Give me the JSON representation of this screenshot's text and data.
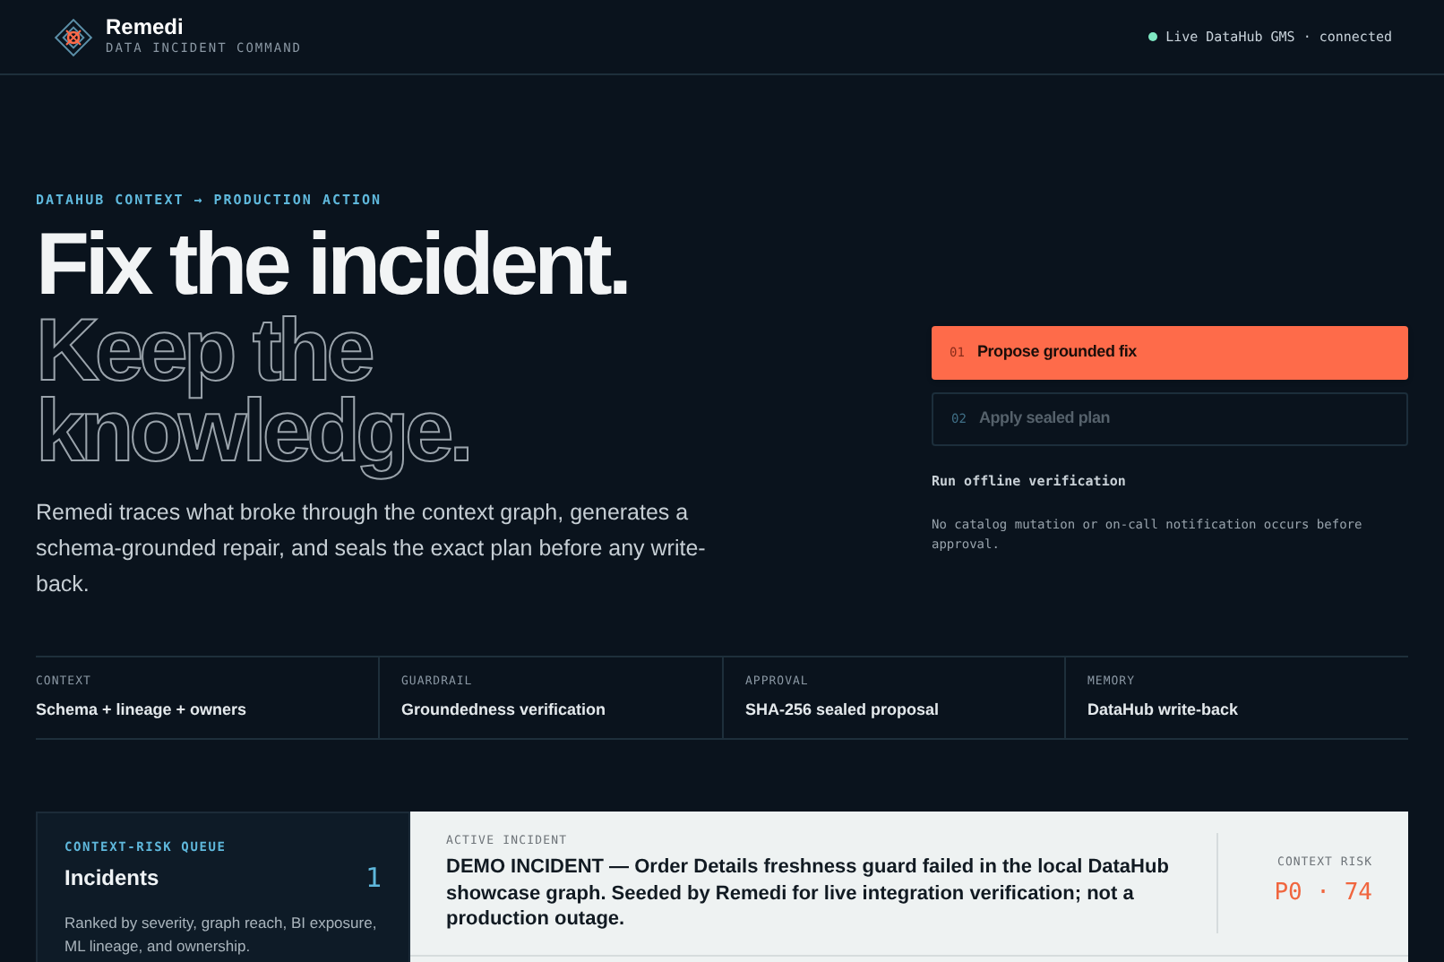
{
  "header": {
    "brand": "Remedi",
    "tagline": "DATA INCIDENT COMMAND",
    "status": {
      "label": "Live DataHub GMS · connected",
      "on": true
    }
  },
  "hero": {
    "eyebrow": "DATAHUB CONTEXT → PRODUCTION ACTION",
    "headline": "Fix the incident.",
    "outline_lines": [
      "Keep the",
      "knowledge."
    ],
    "body": "Remedi traces what broke through the context graph, generates a schema-grounded repair, and seals the exact plan before any write-back."
  },
  "actions": [
    {
      "number": "01",
      "label": "Propose grounded fix",
      "disabled": false
    },
    {
      "number": "02",
      "label": "Apply sealed plan",
      "disabled": true
    }
  ],
  "verify_link": "Run offline verification",
  "note": "No catalog mutation or on-call notification occurs before approval.",
  "pillars": [
    {
      "label": "CONTEXT",
      "value": "Schema + lineage + owners"
    },
    {
      "label": "GUARDRAIL",
      "value": "Groundedness verification"
    },
    {
      "label": "APPROVAL",
      "value": "SHA-256 sealed proposal"
    },
    {
      "label": "MEMORY",
      "value": "DataHub write-back"
    }
  ],
  "queue": {
    "eyebrow": "CONTEXT-RISK QUEUE",
    "title": "Incidents",
    "count": "1",
    "description": "Ranked by severity, graph reach, BI exposure, ML lineage, and ownership."
  },
  "incident": {
    "eyebrow": "ACTIVE INCIDENT",
    "title": "DEMO INCIDENT — Order Details freshness guard failed in the local DataHub showcase graph. Seeded by Remedi for live integration verification; not a production outage.",
    "risk_label": "CONTEXT RISK",
    "risk_value": "P0 · 74"
  }
}
